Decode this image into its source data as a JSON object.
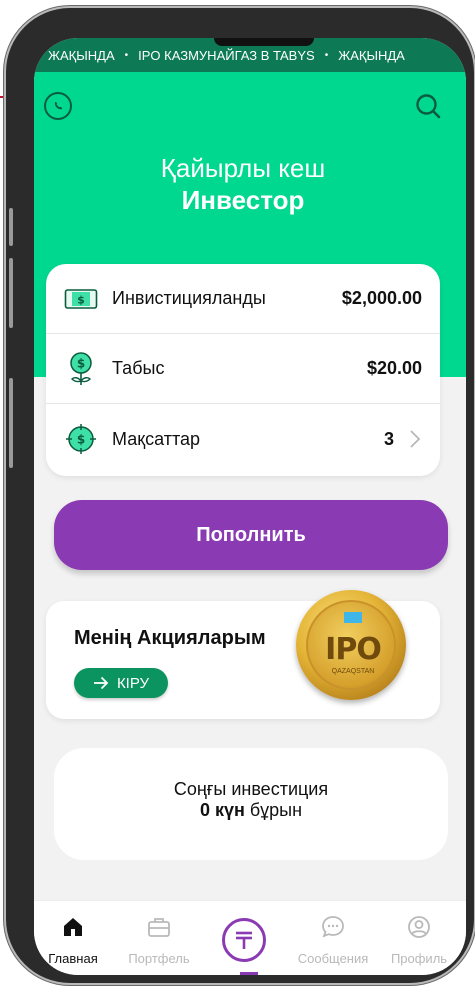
{
  "ticker": {
    "items": [
      "ЖАҚЫНДА",
      "IPO КАЗМУНАЙГАЗ В TABYS",
      "ЖАҚЫНДА"
    ],
    "separator": "•"
  },
  "header": {
    "whatsapp_icon": "whatsapp-icon",
    "search_icon": "search-icon",
    "greeting": "Қайырлы кеш",
    "user_name": "Инвестор"
  },
  "stats": [
    {
      "icon": "cash-icon",
      "label": "Инвистицияланды",
      "value": "$2,000.00"
    },
    {
      "icon": "plant-dollar-icon",
      "label": "Табыс",
      "value": "$20.00"
    },
    {
      "icon": "target-dollar-icon",
      "label": "Мақсаттар",
      "value": "3"
    }
  ],
  "topup_label": "Пополнить",
  "shares": {
    "title": "Менің Акцияларым",
    "enter_label": "КІРУ",
    "coin_text": "IPO",
    "coin_sub": "QAZAQSTAN"
  },
  "last_investment": {
    "title": "Соңғы инвестиция",
    "value": "0 күн",
    "suffix": "бұрын"
  },
  "tabs": [
    {
      "label": "Главная",
      "icon": "home-icon",
      "active": true
    },
    {
      "label": "Портфель",
      "icon": "briefcase-icon",
      "active": false
    },
    {
      "label": "",
      "icon": "tenge-icon",
      "active": false
    },
    {
      "label": "Сообщения",
      "icon": "chat-icon",
      "active": false
    },
    {
      "label": "Профиль",
      "icon": "profile-icon",
      "active": false
    }
  ],
  "colors": {
    "header_green": "#00d88f",
    "ticker_green": "#0d7a55",
    "accent_purple": "#8a3ab3",
    "button_green": "#0c9460"
  }
}
